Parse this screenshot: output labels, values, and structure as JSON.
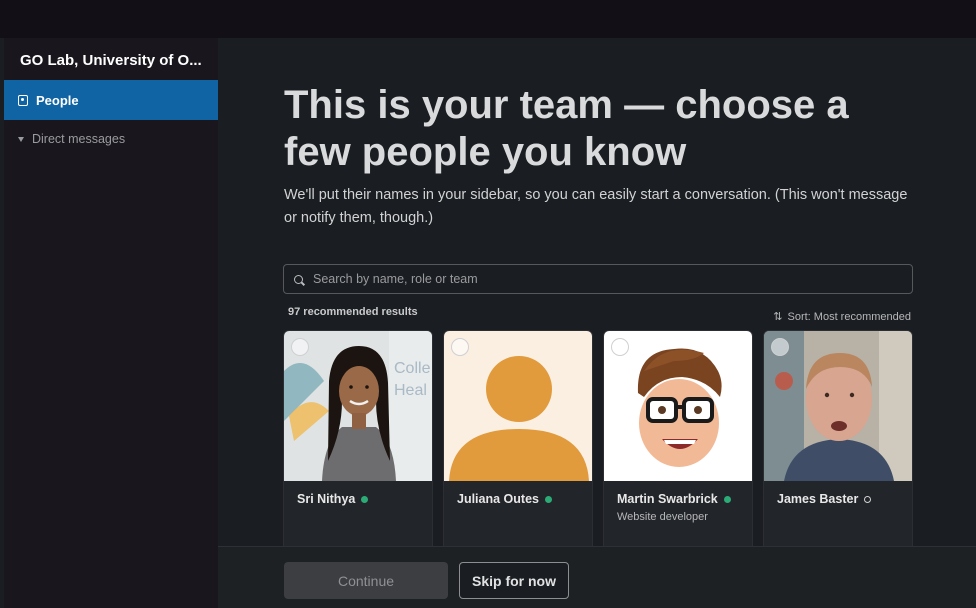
{
  "workspace": {
    "name": "GO Lab, University of O..."
  },
  "sidebar": {
    "people_label": "People",
    "direct_messages_label": "Direct messages"
  },
  "main": {
    "headline": "This is your team — choose a few people you know",
    "subtext": "We'll put their names in your sidebar, so you can easily start a conversation. (This won't message or notify them, though.)",
    "search_placeholder": "Search by name, role or team",
    "results_count": "97 recommended results",
    "sort_label": "Sort: Most recommended",
    "people": [
      {
        "name": "Sri Nithya",
        "status": "active",
        "role": "",
        "avatar": "photo-woman"
      },
      {
        "name": "Juliana Outes",
        "status": "active",
        "role": "",
        "avatar": "default-avatar"
      },
      {
        "name": "Martin Swarbrick",
        "status": "active",
        "role": "Website developer",
        "avatar": "memoji"
      },
      {
        "name": "James Baster",
        "status": "away",
        "role": "",
        "avatar": "photo-man"
      }
    ]
  },
  "footer": {
    "continue_label": "Continue",
    "skip_label": "Skip for now"
  },
  "colors": {
    "accent": "#1164a3",
    "active_status": "#2bac76",
    "background": "#1a1d21",
    "default_avatar": "#e19a3c"
  }
}
